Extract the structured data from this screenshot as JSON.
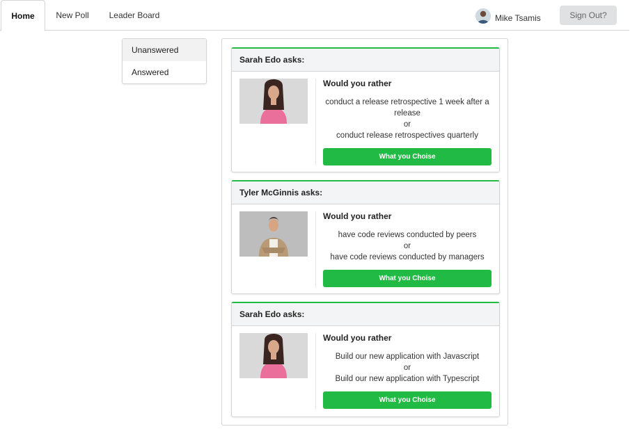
{
  "nav": {
    "tabs": [
      {
        "label": "Home",
        "active": true
      },
      {
        "label": "New Poll",
        "active": false
      },
      {
        "label": "Leader Board",
        "active": false
      }
    ],
    "user_name": "Mike Tsamis",
    "signout_label": "Sign Out?"
  },
  "sidebar": {
    "items": [
      {
        "label": "Unanswered",
        "active": true
      },
      {
        "label": "Answered",
        "active": false
      }
    ]
  },
  "polls": [
    {
      "author": "Sarah Edo asks:",
      "prompt": "Would you rather",
      "option_one": "conduct a release retrospective 1 week after a release",
      "or": "or",
      "option_two": "conduct release retrospectives quarterly",
      "button": "What you Choise"
    },
    {
      "author": "Tyler McGinnis asks:",
      "prompt": "Would you rather",
      "option_one": "have code reviews conducted by peers",
      "or": "or",
      "option_two": "have code reviews conducted by managers",
      "button": "What you Choise"
    },
    {
      "author": "Sarah Edo asks:",
      "prompt": "Would you rather",
      "option_one": "Build our new application with Javascript",
      "or": "or",
      "option_two": "Build our new application with Typescript",
      "button": "What you Choise"
    }
  ],
  "colors": {
    "accent": "#21ba45",
    "header_bg": "#f3f4f5",
    "signout_bg": "#e0e1e2"
  }
}
